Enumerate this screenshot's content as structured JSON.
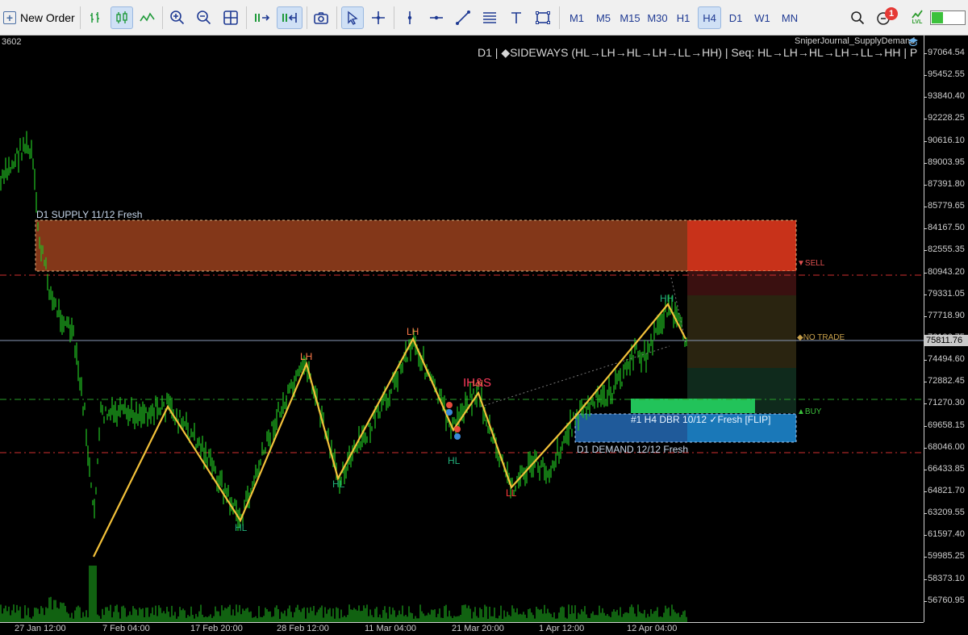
{
  "toolbar": {
    "new_order_label": "New Order",
    "timeframes": [
      "M1",
      "M5",
      "M15",
      "M30",
      "H1",
      "H4",
      "D1",
      "W1",
      "MN"
    ],
    "active_timeframe": "H4",
    "notification_count": "1",
    "lvl_label": "LVL",
    "lvl_fill_fraction": 0.35,
    "icons": [
      "bar-chart-icon",
      "candlestick-icon",
      "line-chart-icon",
      "zoom-in-icon",
      "zoom-out-icon",
      "grid-icon",
      "auto-scroll-icon",
      "chart-shift-icon",
      "screenshot-icon",
      "cursor-icon",
      "crosshair-icon",
      "vertical-line-icon",
      "horizontal-line-icon",
      "trendline-icon",
      "channel-icon",
      "text-icon",
      "rectangle-icon",
      "search-icon",
      "notification-icon",
      "signal-icon"
    ]
  },
  "chart": {
    "top_left_number": "3602",
    "indicator_name": "SniperJournal_SupplyDemand",
    "status_line": "D1 | ◆SIDEWAYS (HL→LH→HL→LH→LL→HH) | Seq: HL→LH→HL→LH→LL→HH | P",
    "supply_zone_label": "D1 SUPPLY 11/12 Fresh",
    "demand_zone_label": "D1 DEMAND 12/12 Fresh",
    "dbr_zone_label": "#1 H4 DBR 10/12 ✓Fresh [FLIP]",
    "hs_label": "IH&S",
    "sell_label": "▼SELL",
    "no_trade_label": "◆NO TRADE",
    "buy_label": "▲BUY",
    "pivots": [
      {
        "label": "HL",
        "kind": "low"
      },
      {
        "label": "LH",
        "kind": "high"
      },
      {
        "label": "HL",
        "kind": "low"
      },
      {
        "label": "LH",
        "kind": "high"
      },
      {
        "label": "HL",
        "kind": "low"
      },
      {
        "label": "LL",
        "kind": "ll"
      },
      {
        "label": "HH",
        "kind": "low"
      },
      {
        "label": "LH",
        "kind": "high"
      }
    ],
    "current_price": "75811.76",
    "colors": {
      "candle": "#22c322",
      "zigzag": "#f3c13a",
      "supply_zone": "#8a3a1a",
      "supply_zone_right": "#c8321a",
      "demand_zone": "#1f5a9a",
      "sell_line": "#d23030",
      "buy_line": "#2aa02a",
      "buy_box": "#22c35a"
    }
  },
  "price_axis": [
    "97064.54",
    "95452.55",
    "93840.40",
    "92228.25",
    "90616.10",
    "89003.95",
    "87391.80",
    "85779.65",
    "84167.50",
    "82555.35",
    "80943.20",
    "79331.05",
    "77718.90",
    "76106.75",
    "74494.60",
    "72882.45",
    "71270.30",
    "69658.15",
    "68046.00",
    "66433.85",
    "64821.70",
    "63209.55",
    "61597.40",
    "59985.25",
    "58373.10",
    "56760.95"
  ],
  "time_axis": [
    "27 Jan 12:00",
    "7 Feb 04:00",
    "17 Feb 20:00",
    "28 Feb 12:00",
    "11 Mar 04:00",
    "21 Mar 20:00",
    "1 Apr 12:00",
    "12 Apr 04:00"
  ]
}
